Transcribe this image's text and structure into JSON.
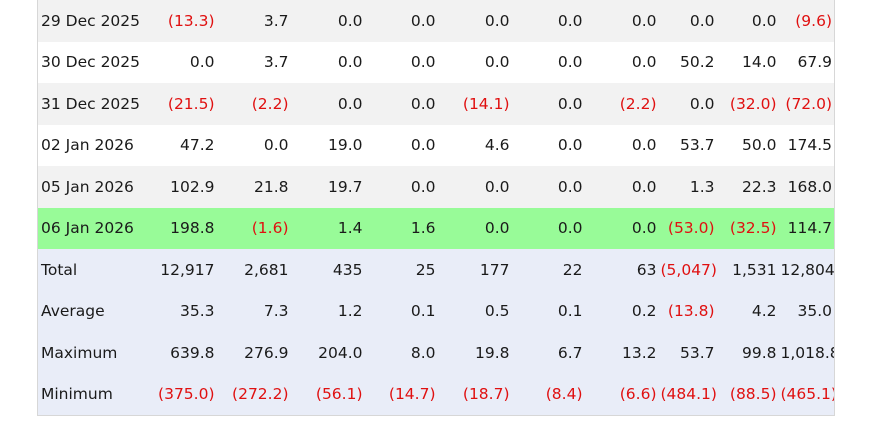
{
  "colors": {
    "negative_text": "#e01010",
    "highlight_row": "#98fb98",
    "summary_row": "#e9edf8",
    "alt_row": "#f2f2f2"
  },
  "rows": [
    {
      "label": "29 Dec 2025",
      "style": "gray",
      "values": [
        "(13.3)",
        "3.7",
        "0.0",
        "0.0",
        "0.0",
        "0.0",
        "0.0",
        "0.0",
        "0.0",
        "(9.6)"
      ]
    },
    {
      "label": "30 Dec 2025",
      "style": "white",
      "values": [
        "0.0",
        "3.7",
        "0.0",
        "0.0",
        "0.0",
        "0.0",
        "0.0",
        "50.2",
        "14.0",
        "67.9"
      ]
    },
    {
      "label": "31 Dec 2025",
      "style": "gray",
      "values": [
        "(21.5)",
        "(2.2)",
        "0.0",
        "0.0",
        "(14.1)",
        "0.0",
        "(2.2)",
        "0.0",
        "(32.0)",
        "(72.0)"
      ]
    },
    {
      "label": "02 Jan 2026",
      "style": "white",
      "values": [
        "47.2",
        "0.0",
        "19.0",
        "0.0",
        "4.6",
        "0.0",
        "0.0",
        "53.7",
        "50.0",
        "174.5"
      ]
    },
    {
      "label": "05 Jan 2026",
      "style": "gray",
      "values": [
        "102.9",
        "21.8",
        "19.7",
        "0.0",
        "0.0",
        "0.0",
        "0.0",
        "1.3",
        "22.3",
        "168.0"
      ]
    },
    {
      "label": "06 Jan 2026",
      "style": "highlight",
      "values": [
        "198.8",
        "(1.6)",
        "1.4",
        "1.6",
        "0.0",
        "0.0",
        "0.0",
        "(53.0)",
        "(32.5)",
        "114.7"
      ]
    },
    {
      "label": "Total",
      "style": "summary",
      "values": [
        "12,917",
        "2,681",
        "435",
        "25",
        "177",
        "22",
        "63",
        "(5,047)",
        "1,531",
        "12,804"
      ]
    },
    {
      "label": "Average",
      "style": "summary",
      "values": [
        "35.3",
        "7.3",
        "1.2",
        "0.1",
        "0.5",
        "0.1",
        "0.2",
        "(13.8)",
        "4.2",
        "35.0"
      ]
    },
    {
      "label": "Maximum",
      "style": "summary",
      "values": [
        "639.8",
        "276.9",
        "204.0",
        "8.0",
        "19.8",
        "6.7",
        "13.2",
        "53.7",
        "99.8",
        "1,018.8"
      ]
    },
    {
      "label": "Minimum",
      "style": "summary",
      "values": [
        "(375.0)",
        "(272.2)",
        "(56.1)",
        "(14.7)",
        "(18.7)",
        "(8.4)",
        "(6.6)",
        "(484.1)",
        "(88.5)",
        "(465.1)"
      ]
    }
  ]
}
